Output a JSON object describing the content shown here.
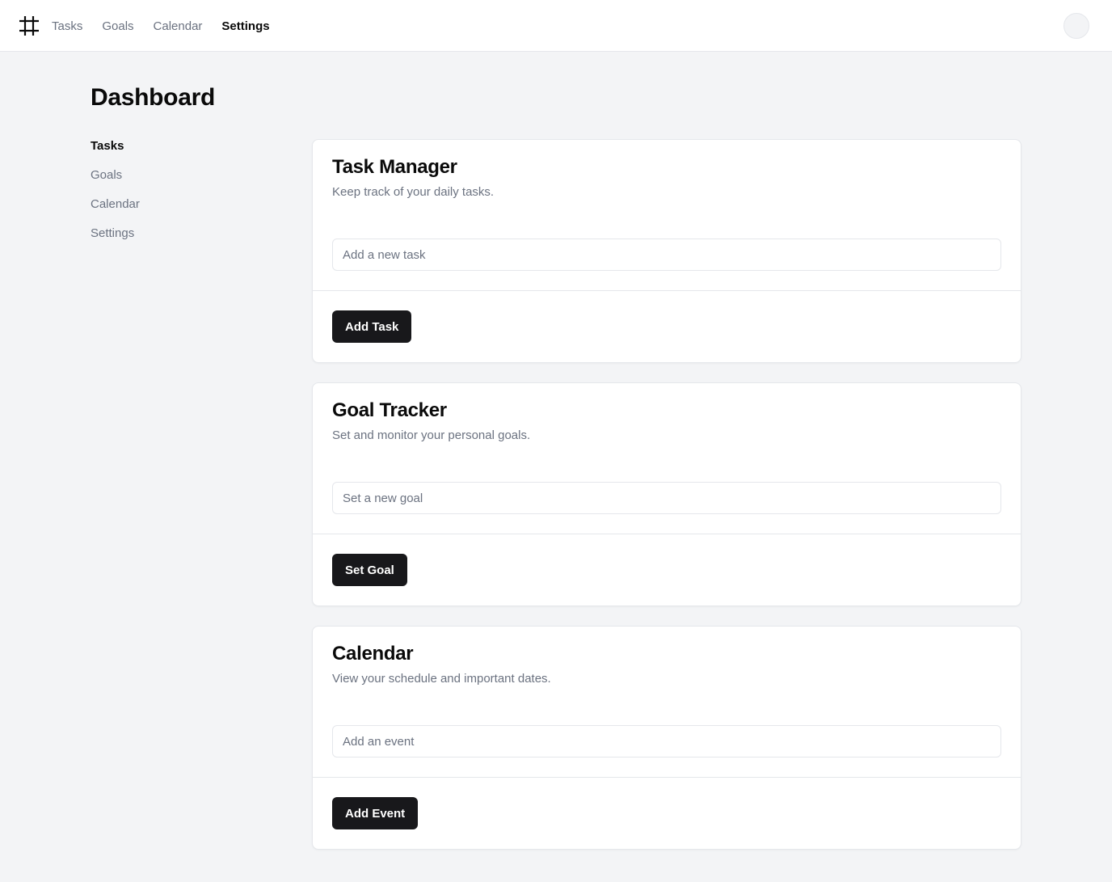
{
  "nav": {
    "logo_icon": "hash-icon",
    "items": [
      {
        "label": "Tasks"
      },
      {
        "label": "Goals"
      },
      {
        "label": "Calendar"
      },
      {
        "label": "Settings"
      }
    ],
    "active": "Settings"
  },
  "page": {
    "title": "Dashboard"
  },
  "sidebar": {
    "items": [
      {
        "label": "Tasks"
      },
      {
        "label": "Goals"
      },
      {
        "label": "Calendar"
      },
      {
        "label": "Settings"
      }
    ],
    "active": "Tasks"
  },
  "cards": [
    {
      "title": "Task Manager",
      "description": "Keep track of your daily tasks.",
      "placeholder": "Add a new task",
      "value": "",
      "button": "Add Task"
    },
    {
      "title": "Goal Tracker",
      "description": "Set and monitor your personal goals.",
      "placeholder": "Set a new goal",
      "value": "",
      "button": "Set Goal"
    },
    {
      "title": "Calendar",
      "description": "View your schedule and important dates.",
      "placeholder": "Add an event",
      "value": "",
      "button": "Add Event"
    }
  ],
  "colors": {
    "background": "#f3f4f6",
    "card": "#ffffff",
    "primary_button": "#18181b",
    "muted_text": "#6b7280",
    "border": "#e5e7eb"
  }
}
